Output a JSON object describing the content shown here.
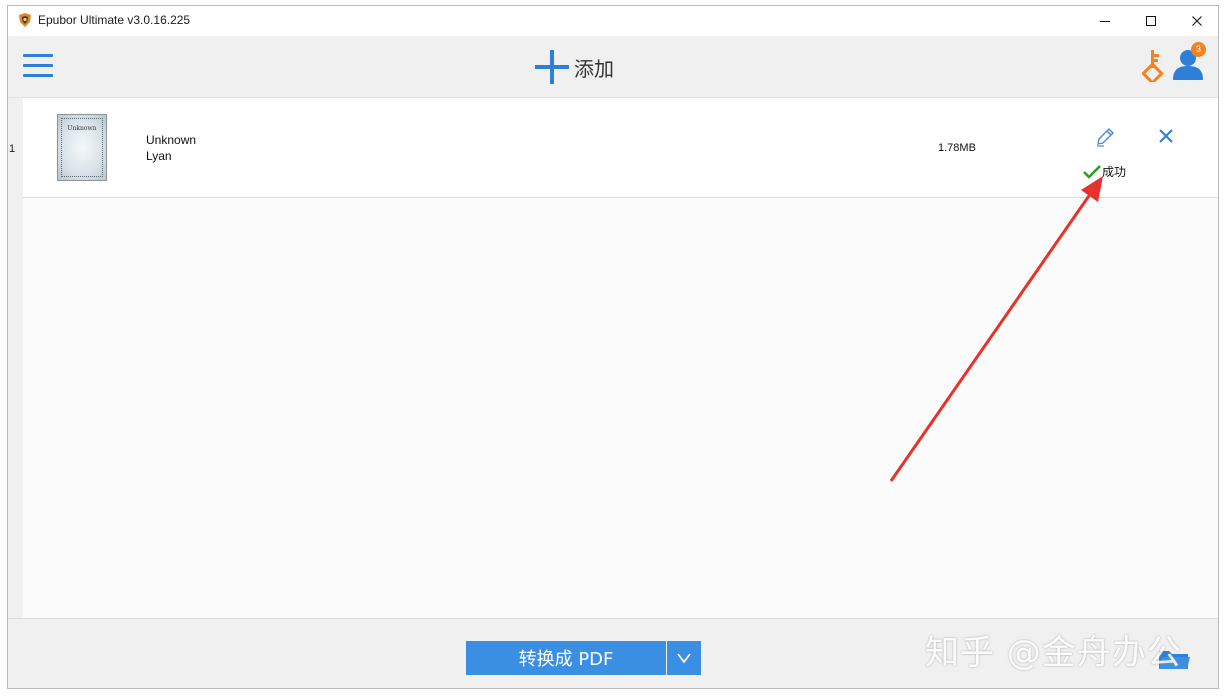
{
  "window": {
    "title": "Epubor Ultimate v3.0.16.225"
  },
  "toolbar": {
    "add_label": "添加",
    "notification_count": "3",
    "accent_color": "#2f7ed8",
    "key_color": "#f5821f"
  },
  "books": [
    {
      "index": "1",
      "cover_title": "Unknown",
      "title": "Unknown",
      "author": "Lyan",
      "size": "1.78MB",
      "status": "成功"
    }
  ],
  "bottom": {
    "convert_label": "转换成 PDF"
  },
  "watermark": "知乎 @金舟办公"
}
